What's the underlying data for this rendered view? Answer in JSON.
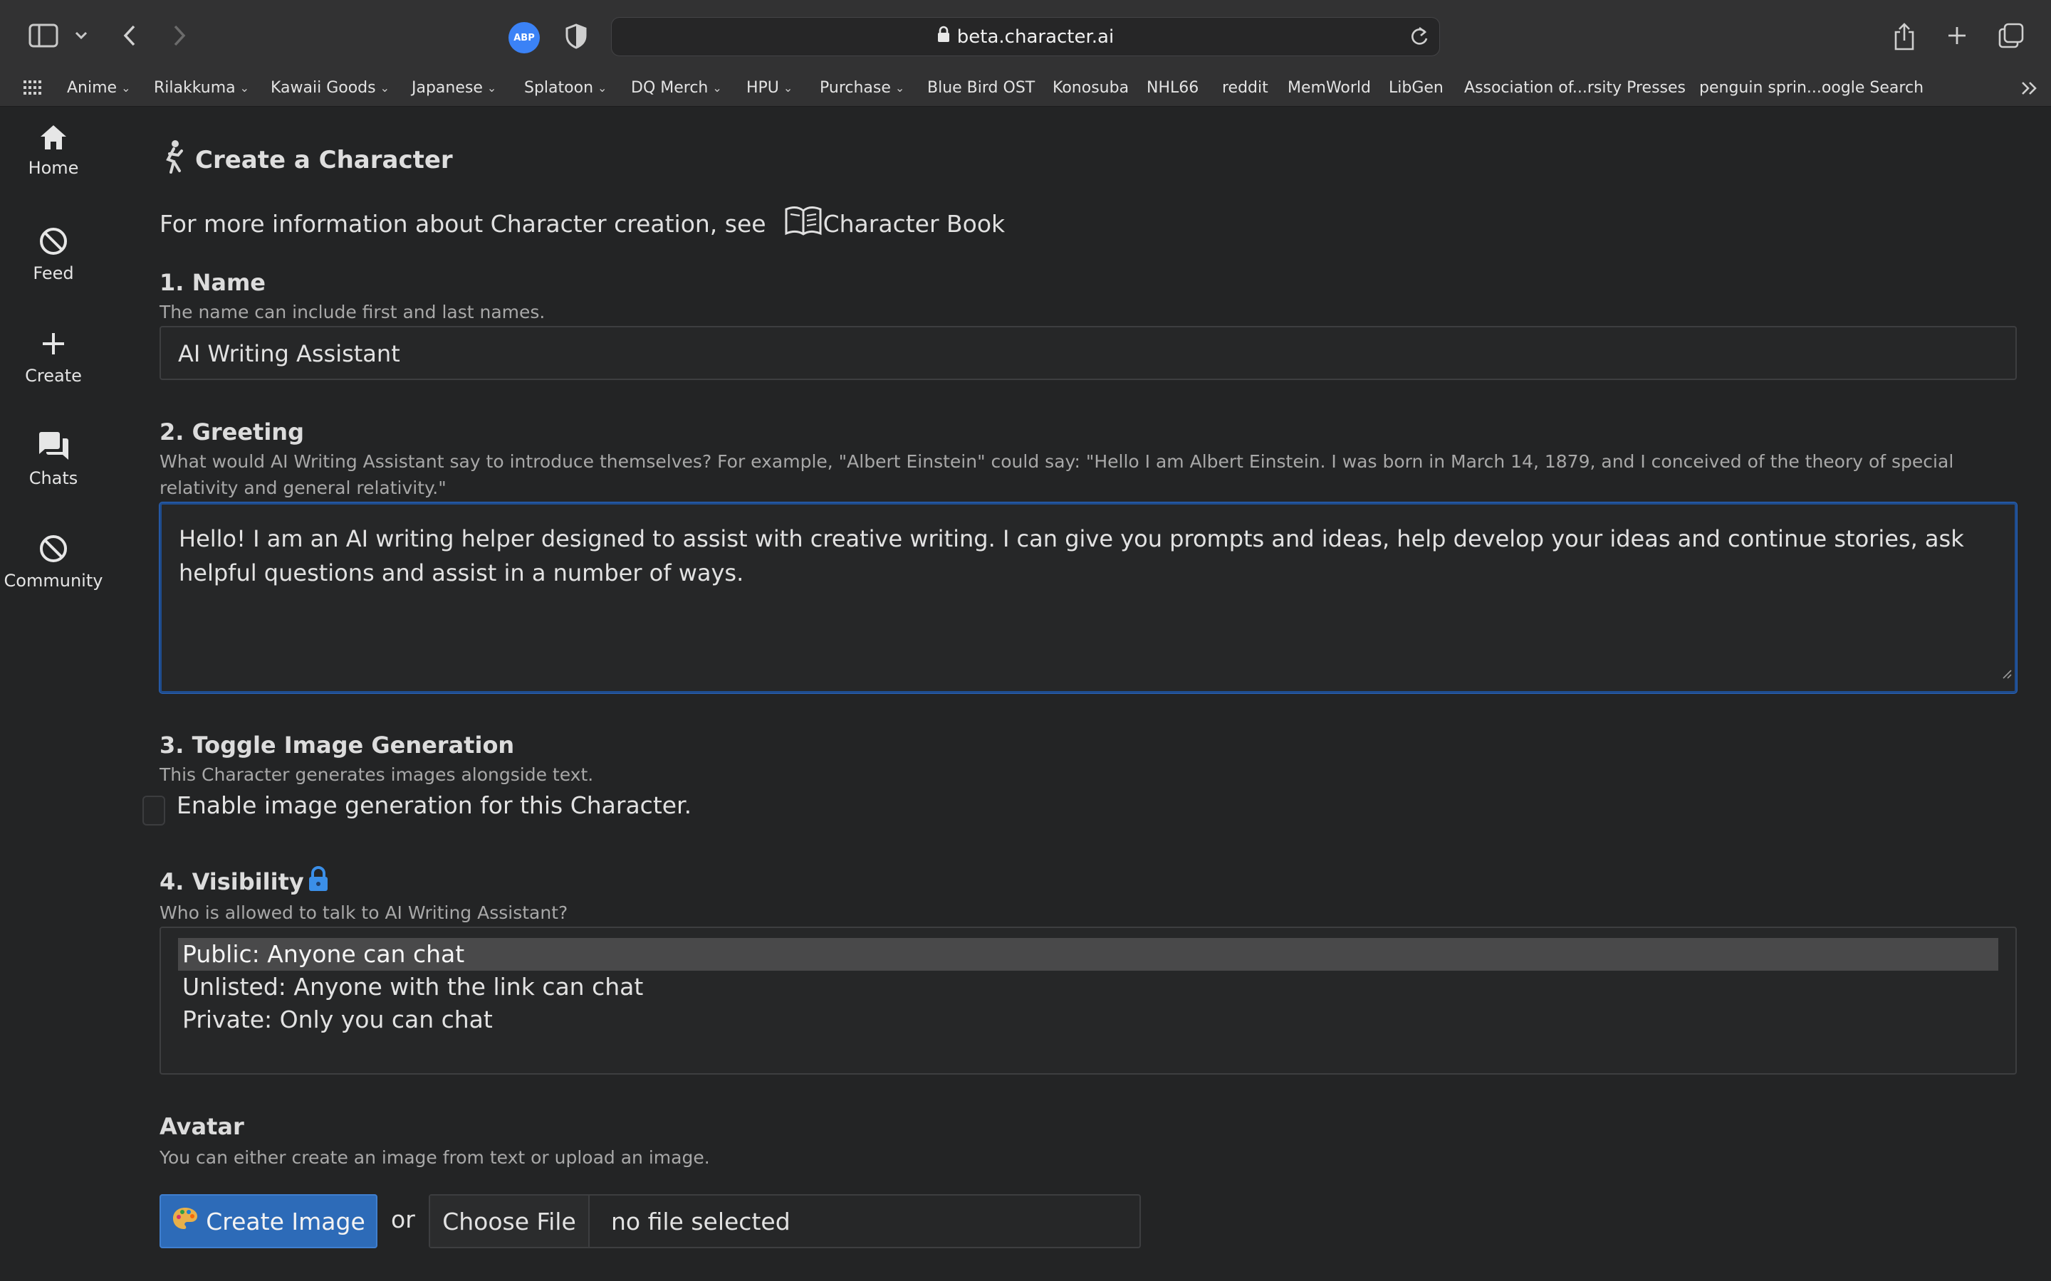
{
  "browser": {
    "url": "beta.character.ai",
    "abp_label": "ABP",
    "bookmarks": [
      {
        "label": "Anime",
        "folder": true
      },
      {
        "label": "Rilakkuma",
        "folder": true
      },
      {
        "label": "Kawaii Goods",
        "folder": true
      },
      {
        "label": "Japanese",
        "folder": true
      },
      {
        "label": "Splatoon",
        "folder": true
      },
      {
        "label": "DQ Merch",
        "folder": true
      },
      {
        "label": "HPU",
        "folder": true
      },
      {
        "label": "Purchase",
        "folder": true
      },
      {
        "label": "Blue Bird OST",
        "folder": false
      },
      {
        "label": "Konosuba",
        "folder": false
      },
      {
        "label": "NHL66",
        "folder": false
      },
      {
        "label": "reddit",
        "folder": false
      },
      {
        "label": "MemWorld",
        "folder": false
      },
      {
        "label": "LibGen",
        "folder": false
      },
      {
        "label": "Association of...rsity Presses",
        "folder": false
      },
      {
        "label": "penguin sprin...oogle Search",
        "folder": false
      }
    ]
  },
  "sidebar": {
    "items": [
      {
        "label": "Home",
        "icon": "home-icon"
      },
      {
        "label": "Feed",
        "icon": "prohibited-icon"
      },
      {
        "label": "Create",
        "icon": "plus-icon"
      },
      {
        "label": "Chats",
        "icon": "chat-bubbles-icon"
      },
      {
        "label": "Community",
        "icon": "prohibited-icon"
      }
    ]
  },
  "page": {
    "title": "Create a Character",
    "info_text": "For more information about Character creation, see",
    "info_link": "Character Book"
  },
  "name_section": {
    "heading": "1. Name",
    "hint": "The name can include first and last names.",
    "value": "AI Writing Assistant"
  },
  "greeting_section": {
    "heading": "2. Greeting",
    "hint": "What would AI Writing Assistant say to introduce themselves? For example, \"Albert Einstein\" could say: \"Hello I am Albert Einstein. I was born in March 14, 1879, and I conceived of the theory of special relativity and general relativity.\"",
    "value": "Hello! I am an AI writing helper designed to assist with creative writing. I can give you prompts and ideas, help develop your ideas and continue stories, ask helpful questions and assist in a number of ways."
  },
  "image_gen_section": {
    "heading": "3. Toggle Image Generation",
    "hint": "This Character generates images alongside text.",
    "checkbox_label": "Enable image generation for this Character.",
    "checked": false
  },
  "visibility_section": {
    "heading": "4. Visibility",
    "hint": "Who is allowed to talk to AI Writing Assistant?",
    "options": [
      "Public: Anyone can chat",
      "Unlisted: Anyone with the link can chat",
      "Private: Only you can chat"
    ],
    "selected": "Public: Anyone can chat"
  },
  "avatar_section": {
    "heading": "Avatar",
    "hint": "You can either create an image from text or upload an image.",
    "create_button": "Create Image",
    "or_text": "or",
    "choose_file": "Choose File",
    "file_status": "no file selected"
  },
  "colors": {
    "background": "#232425",
    "accent_blue": "#2d6bb8",
    "lock_blue": "#3b8fe8"
  }
}
